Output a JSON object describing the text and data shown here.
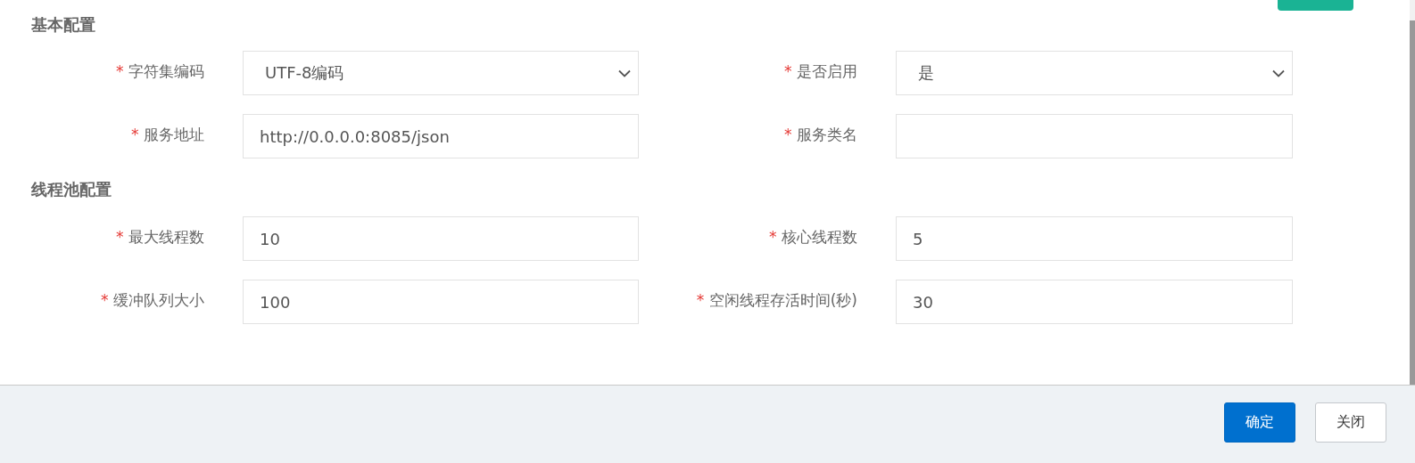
{
  "sections": [
    {
      "title": "基本配置",
      "fields": [
        {
          "label": "字符集编码",
          "mark": "*",
          "kind": "select",
          "value": "UTF-8编码"
        },
        {
          "label": "是否启用",
          "mark": "*",
          "kind": "select",
          "value": "是"
        },
        {
          "label": "服务地址",
          "mark": "*",
          "kind": "input",
          "value": "http://0.0.0.0:8085/json"
        },
        {
          "label": "服务类名",
          "mark": "*",
          "kind": "input"
        }
      ]
    },
    {
      "title": "线程池配置",
      "fields": [
        {
          "label": "最大线程数",
          "mark": "*",
          "kind": "input",
          "value": "10"
        },
        {
          "label": "核心线程数",
          "mark": "*",
          "kind": "input",
          "value": "5"
        },
        {
          "label": "缓冲队列大小",
          "mark": "*",
          "kind": "input",
          "value": "100"
        },
        {
          "label": "空闲线程存活时间(秒)",
          "mark": "*",
          "kind": "input",
          "value": "30"
        }
      ]
    }
  ],
  "footer_buttons": [
    {
      "label": "确定",
      "kind": "primary"
    },
    {
      "label": "关闭",
      "kind": "default"
    }
  ]
}
